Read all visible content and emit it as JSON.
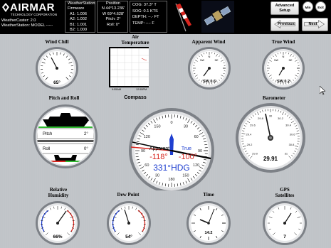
{
  "header": {
    "brand_name": "AIRMAR",
    "brand_sub": "TECHNOLOGY CORPORATION",
    "device_line1": "WeatherCaster: 2.0",
    "device_line2": "WeatherStation: MODEL -----",
    "firmware": {
      "title_line1": "WeatherStation",
      "title_line2": "Firmware",
      "a1": "A1: 1.006",
      "a2": "A2: 1.002",
      "b1": "B1: 1.001",
      "b2": "B2: 1.000"
    },
    "position": {
      "title": "Position",
      "lat": "N 44°13.236'",
      "lon": "W 69°4.628'",
      "pitch": "Pitch: 2°",
      "roll": "Roll: 0°"
    },
    "nav": {
      "cog": "COG: 37.3° T",
      "sog": "SOG: 0.1 KTS",
      "depth": "DEPTH: --.- FT",
      "temp": "TEMP: --.- F"
    },
    "icons": [
      "windsock-icon",
      "satellite-icon"
    ],
    "buttons": {
      "advanced_line1": "Advanced",
      "advanced_line2": "Setup",
      "min": "Min",
      "exit": "Exit",
      "previous": "Previous",
      "next": "Next"
    }
  },
  "gauges": {
    "wind_chill": {
      "title": "Wind Chill",
      "value": "65°"
    },
    "air_temperature": {
      "title_line1": "Air",
      "title_line2": "Temperature",
      "x_start": "9:55AM",
      "x_end": "12:55PM"
    },
    "apparent_wind": {
      "title": "Apparent Wind",
      "value": "SW 0.6"
    },
    "true_wind": {
      "title": "True Wind",
      "value": "SW 0.2"
    },
    "pitch_roll": {
      "title": "Pitch and Roll",
      "pitch_label": "Pitch",
      "pitch_value": "2°",
      "roll_label": "Roll",
      "roll_value": "0°"
    },
    "compass": {
      "title": "Compass",
      "apparent_label": "Apparent",
      "apparent_value": "-118°",
      "true_label": "True",
      "true_value": "-100°",
      "heading": "331°HDG",
      "ticks": [
        "0",
        "30",
        "60",
        "90",
        "120",
        "150",
        "180",
        "30",
        "60",
        "90",
        "120",
        "150"
      ]
    },
    "barometer": {
      "title": "Barometer",
      "value": "29.91",
      "ticks": [
        "29.0",
        "29.2",
        "29.4",
        "29.6",
        "29.8",
        "30",
        "30.2",
        "30.4",
        "30.6",
        "30.8",
        "31"
      ]
    },
    "humidity": {
      "title_line1": "Relative",
      "title_line2": "Humidity",
      "value": "66%"
    },
    "dew_point": {
      "title": "Dew Point",
      "value": "54°"
    },
    "time": {
      "title": "Time",
      "value": "14:2"
    },
    "gps": {
      "title_line1": "GPS",
      "title_line2": "Satellites",
      "value": "7"
    }
  },
  "colors": {
    "accent_red": "#d8261f",
    "accent_blue": "#1f3fd0",
    "bezel": "#8a8e94",
    "face": "#ffffff"
  }
}
